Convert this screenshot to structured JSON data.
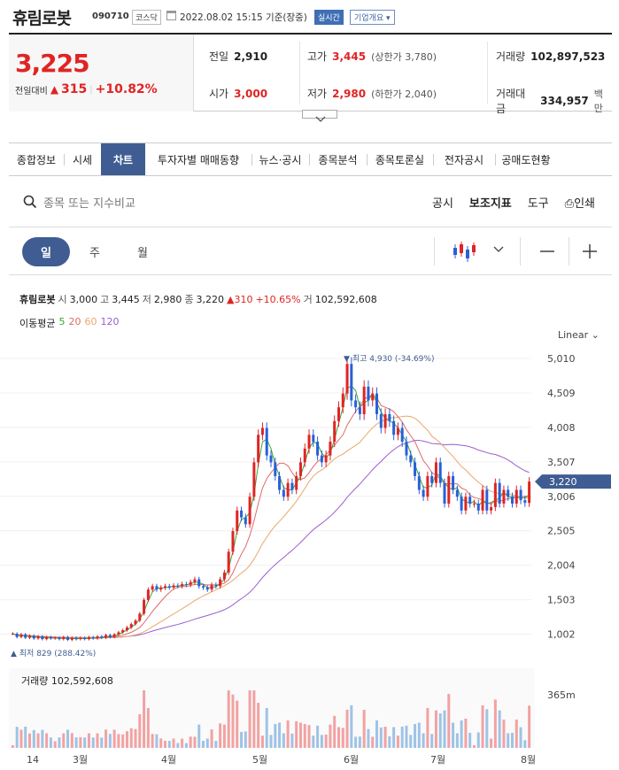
{
  "header": {
    "name": "휴림로봇",
    "code": "090710",
    "market": "코스닥",
    "datetime": "2022.08.02 15:15 기준(장중)",
    "realtime": "실시간",
    "company_info": "기업개요"
  },
  "quote": {
    "price": "3,225",
    "change_label": "전일대비",
    "change_arrow": "▲",
    "change": "315",
    "change_pct": "+10.82%",
    "prev_label": "전일",
    "prev": "2,910",
    "high_label": "고가",
    "high": "3,445",
    "upper_limit": "(상한가 3,780)",
    "volume_label": "거래량",
    "volume": "102,897,523",
    "open_label": "시가",
    "open": "3,000",
    "low_label": "저가",
    "low": "2,980",
    "lower_limit": "(하한가 2,040)",
    "amount_label": "거래대금",
    "amount": "334,957",
    "amount_unit": "백만"
  },
  "tabs": [
    "종합정보",
    "시세",
    "차트",
    "투자자별 매매동향",
    "뉴스·공시",
    "종목분석",
    "종목토론실",
    "전자공시",
    "공매도현황"
  ],
  "active_tab": "차트",
  "search": {
    "placeholder": "종목 또는 지수비교"
  },
  "tools": {
    "disclosure": "공시",
    "indicator": "보조지표",
    "tool": "도구",
    "print": "인쇄"
  },
  "periods": [
    "일",
    "주",
    "월"
  ],
  "active_period": "일",
  "ohlc": {
    "name": "휴림로봇",
    "o_label": "시",
    "o": "3,000",
    "h_label": "고",
    "h": "3,445",
    "l_label": "저",
    "l": "2,980",
    "c_label": "종",
    "c": "3,220",
    "chg": "▲310",
    "pct": "+10.65%",
    "v_label": "거",
    "v": "102,592,608"
  },
  "ma": {
    "label": "이동평균",
    "p5": "5",
    "p20": "20",
    "p60": "60",
    "p120": "120",
    "c5": "#3aa53a",
    "c20": "#e06a6a",
    "c60": "#e8a86a",
    "c120": "#9a5fd0"
  },
  "scale": {
    "mode": "Linear"
  },
  "colors": {
    "up": "#e02424",
    "down": "#2860d8",
    "accent": "#3f5d92"
  },
  "chart_data": {
    "type": "candlestick",
    "ylim": [
      829,
      5010
    ],
    "y_ticks": [
      "5,010",
      "4,509",
      "4,008",
      "3,507",
      "3,006",
      "2,505",
      "2,004",
      "1,503",
      "1,002"
    ],
    "x_ticks": [
      "14",
      "3월",
      "4월",
      "5월",
      "6월",
      "7월",
      "8월"
    ],
    "high_marker": "최고 4,930 (-34.69%)",
    "low_marker": "최저 829 (288.42%)",
    "last_price": "3,220",
    "volume_label": "거래량",
    "volume_value": "102,592,608",
    "volume_tick": "365m",
    "close": [
      1010,
      960,
      1000,
      950,
      980,
      940,
      970,
      930,
      960,
      940,
      950,
      930,
      960,
      920,
      950,
      930,
      950,
      930,
      960,
      940,
      970,
      950,
      990,
      960,
      1000,
      1030,
      1060,
      1100,
      1150,
      1200,
      1300,
      1500,
      1650,
      1700,
      1650,
      1680,
      1700,
      1680,
      1710,
      1700,
      1730,
      1720,
      1760,
      1800,
      1700,
      1680,
      1650,
      1720,
      1700,
      1800,
      1900,
      2200,
      2500,
      2800,
      2700,
      2600,
      3000,
      3500,
      3900,
      4000,
      3600,
      3500,
      3300,
      3100,
      3000,
      3200,
      3100,
      3300,
      3500,
      3700,
      3900,
      3800,
      3600,
      3500,
      3600,
      3800,
      4100,
      4300,
      4500,
      4930,
      4400,
      4300,
      4200,
      4600,
      4400,
      4500,
      4200,
      4000,
      4200,
      4100,
      3900,
      4000,
      3800,
      3600,
      3500,
      3300,
      3100,
      3000,
      3300,
      3200,
      3500,
      3200,
      2900,
      3300,
      3100,
      3000,
      2800,
      3000,
      2900,
      2900,
      2800,
      3100,
      2800,
      2850,
      3200,
      2900,
      3100,
      3000,
      2900,
      3100,
      2950,
      2910,
      3220
    ],
    "high_point": 4930,
    "low_point": 829
  }
}
